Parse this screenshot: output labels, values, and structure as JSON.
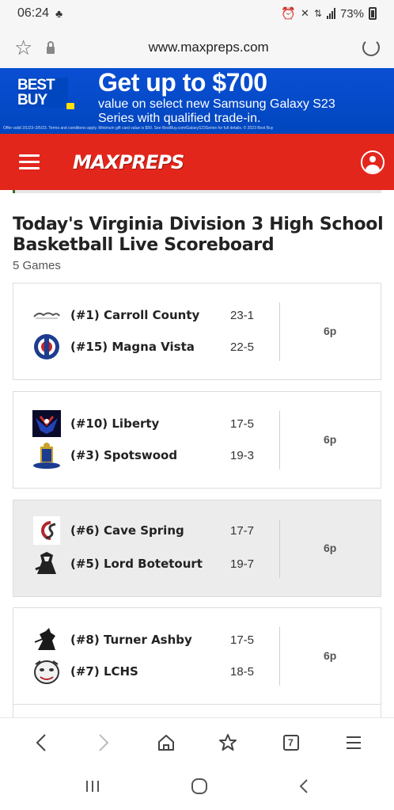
{
  "status_bar": {
    "time": "06:24",
    "battery": "73%"
  },
  "browser": {
    "url": "www.maxpreps.com"
  },
  "ad": {
    "brand_line1": "BEST",
    "brand_line2": "BUY",
    "headline": "Get up to $700",
    "subtext": "value on select new Samsung Galaxy S23 Series with qualified trade-in.",
    "fine_print": "Offer valid 2/1/23–3/5/23. Terms and conditions apply. Minimum gift card value is $50. See BestBuy.com/GalaxyS23Series for full details. © 2023 Best Buy"
  },
  "header": {
    "logo": "MAXPREPS"
  },
  "page": {
    "title": "Today's Virginia Division 3 High School Basketball Live Scoreboard",
    "games_count": "5 Games"
  },
  "games": [
    {
      "time": "6p",
      "teams": [
        {
          "name": "(#1) Carroll County",
          "record": "23-1",
          "logo": "carroll-county-logo"
        },
        {
          "name": "(#15) Magna Vista",
          "record": "22-5",
          "logo": "magna-vista-logo"
        }
      ]
    },
    {
      "time": "6p",
      "teams": [
        {
          "name": "(#10) Liberty",
          "record": "17-5",
          "logo": "liberty-logo"
        },
        {
          "name": "(#3) Spotswood",
          "record": "19-3",
          "logo": "spotswood-logo"
        }
      ]
    },
    {
      "time": "6p",
      "teams": [
        {
          "name": "(#6) Cave Spring",
          "record": "17-7",
          "logo": "cave-spring-logo"
        },
        {
          "name": "(#5) Lord Botetourt",
          "record": "19-7",
          "logo": "lord-botetourt-logo"
        }
      ]
    },
    {
      "time": "6p",
      "teams": [
        {
          "name": "(#8) Turner Ashby",
          "record": "17-5",
          "logo": "turner-ashby-logo"
        },
        {
          "name": "(#7) LCHS",
          "record": "18-5",
          "logo": "lchs-logo"
        }
      ]
    }
  ],
  "toolbar": {
    "tabs_count": "7"
  },
  "colors": {
    "brand_red": "#e3261c",
    "ad_blue": "#0046be",
    "shaded_card": "#ececec"
  }
}
